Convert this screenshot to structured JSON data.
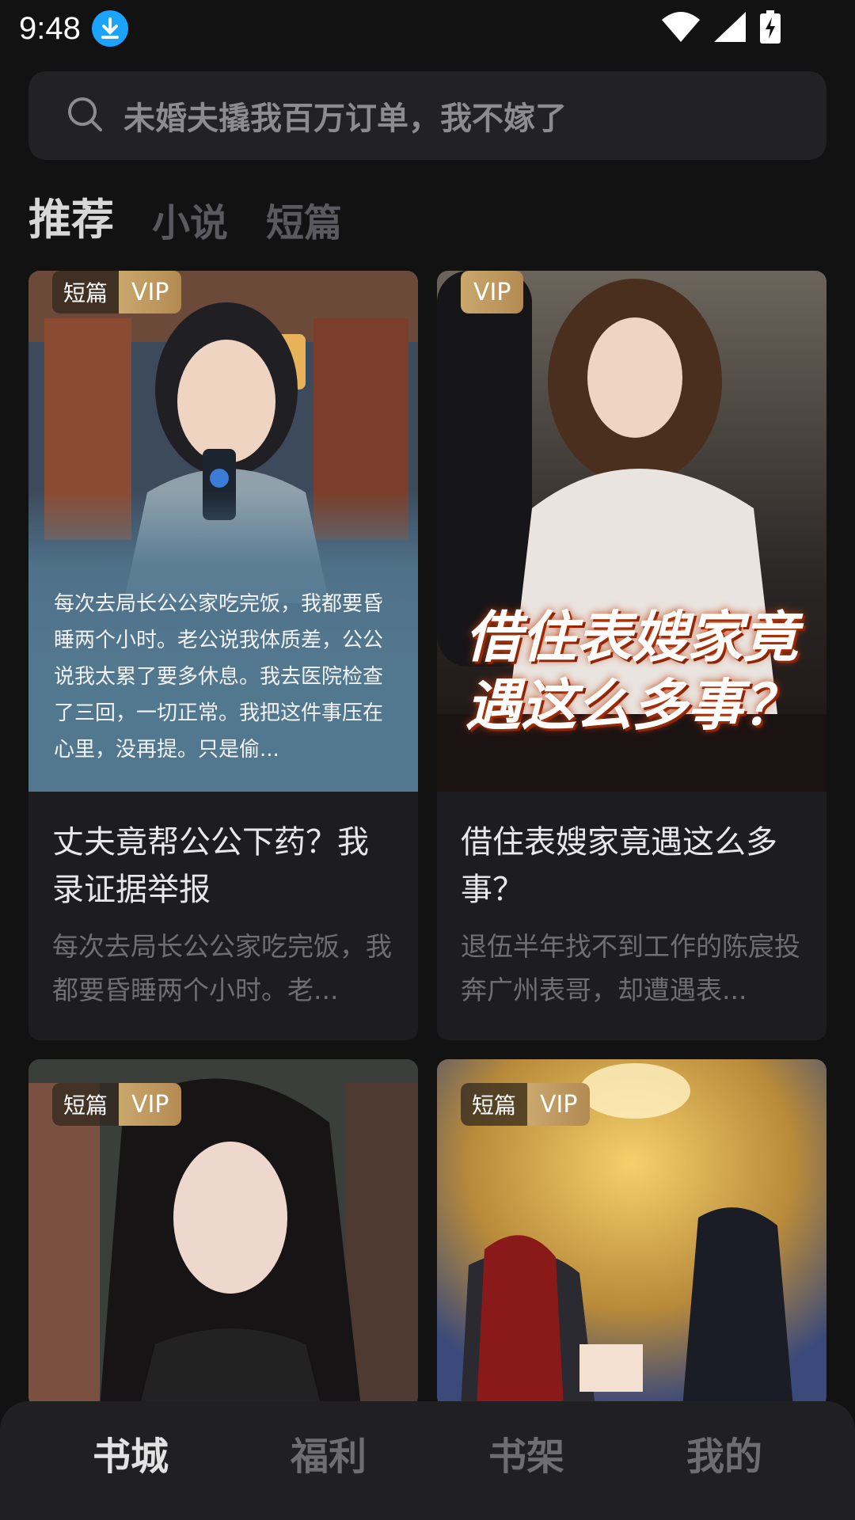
{
  "status_bar": {
    "time": "9:48"
  },
  "search": {
    "placeholder": "未婚夫撬我百万订单，我不嫁了"
  },
  "tabs": [
    {
      "label": "推荐",
      "active": true
    },
    {
      "label": "小说",
      "active": false
    },
    {
      "label": "短篇",
      "active": false
    }
  ],
  "cards": [
    {
      "badge_type": "短篇",
      "badge_vip": "VIP",
      "excerpt": "每次去局长公公家吃完饭，我都要昏睡两个小时。老公说我体质差，公公说我太累了要多休息。我去医院检查了三回，一切正常。我把这件事压在心里，没再提。只是偷...",
      "title": "丈夫竟帮公公下药？我录证据举报",
      "desc": "每次去局长公公家吃完饭，我都要昏睡两个小时。老..."
    },
    {
      "badge_vip": "VIP",
      "cover_title": "借住表嫂家竟遇这么多事？",
      "title": "借住表嫂家竟遇这么多事？",
      "desc": "退伍半年找不到工作的陈宸投奔广州表哥，却遭遇表..."
    },
    {
      "badge_type": "短篇",
      "badge_vip": "VIP"
    },
    {
      "badge_type": "短篇",
      "badge_vip": "VIP"
    }
  ],
  "bottom_nav": [
    {
      "label": "书城",
      "active": true
    },
    {
      "label": "福利",
      "active": false
    },
    {
      "label": "书架",
      "active": false
    },
    {
      "label": "我的",
      "active": false
    }
  ],
  "colors": {
    "background": "#121212",
    "vip_gold": "#c9a86e",
    "excerpt_blue": "#52788f"
  }
}
